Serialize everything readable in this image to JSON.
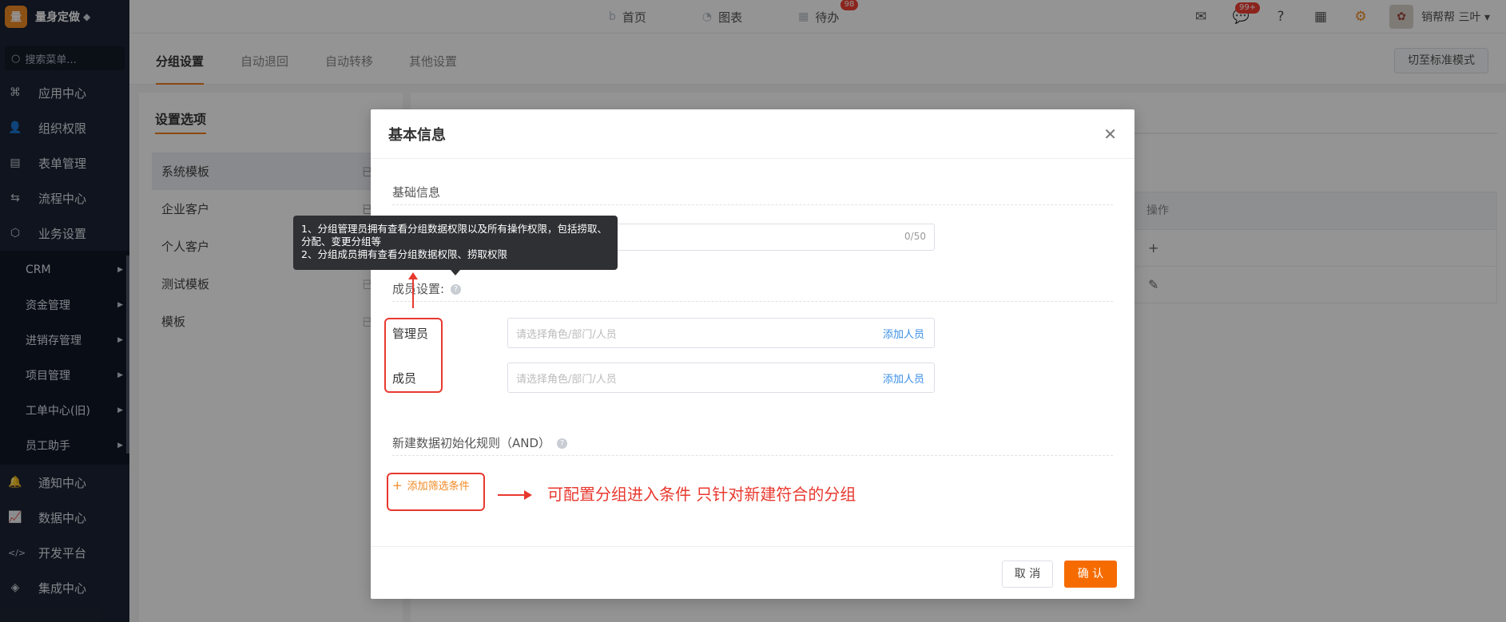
{
  "sidebar": {
    "brand_logo": "量",
    "brand_name": "量身定做",
    "search_placeholder": "搜索菜单...",
    "items_top": [
      {
        "label": "应用中心",
        "icon": "apps-icon",
        "glyph": "⌘"
      },
      {
        "label": "组织权限",
        "icon": "user-icon",
        "glyph": "👤"
      },
      {
        "label": "表单管理",
        "icon": "form-icon",
        "glyph": "▤"
      },
      {
        "label": "流程中心",
        "icon": "flow-icon",
        "glyph": "⇆"
      },
      {
        "label": "业务设置",
        "icon": "cube-icon",
        "glyph": "⬡"
      }
    ],
    "sub_items": [
      "CRM",
      "资金管理",
      "进销存管理",
      "项目管理",
      "工单中心(旧)",
      "员工助手"
    ],
    "items_bottom": [
      {
        "label": "通知中心",
        "icon": "bell-icon",
        "glyph": "🔔"
      },
      {
        "label": "数据中心",
        "icon": "chart-icon",
        "glyph": "📈"
      },
      {
        "label": "开发平台",
        "icon": "code-icon",
        "glyph": "</>"
      },
      {
        "label": "集成中心",
        "icon": "layers-icon",
        "glyph": "◈"
      }
    ]
  },
  "topbar": {
    "nav": [
      {
        "label": "首页",
        "icon": "home-icon",
        "glyph": "b"
      },
      {
        "label": "图表",
        "icon": "pie-chart-icon",
        "glyph": "◔"
      },
      {
        "label": "待办",
        "icon": "calendar-icon",
        "glyph": "▦",
        "badge": "98"
      }
    ],
    "message_badge": "99+",
    "user_name": "销帮帮 三叶 ▾",
    "avatar_glyph": "✿"
  },
  "tabs": [
    "分组设置",
    "自动退回",
    "自动转移",
    "其他设置"
  ],
  "switch_mode_label": "切至标准模式",
  "left_panel": {
    "title": "设置选项",
    "templates": [
      {
        "name": "系统模板",
        "status": "已启用",
        "active": true
      },
      {
        "name": "企业客户",
        "status": "已启用",
        "active": false
      },
      {
        "name": "个人客户",
        "status": "",
        "active": false
      },
      {
        "name": "测试模板",
        "status": "已停用",
        "active": false
      },
      {
        "name": "模板",
        "status": "已停用",
        "active": false
      }
    ]
  },
  "right_panel": {
    "ops_header": "操作",
    "ops_rows": [
      "+",
      "✎"
    ]
  },
  "modal": {
    "title": "基本信息",
    "section_basic": "基础信息",
    "name_counter": "0/50",
    "section_members": "成员设置:",
    "admin_label": "管理员",
    "member_label": "成员",
    "picker_placeholder": "请选择角色/部门/人员",
    "add_person": "添加人员",
    "section_rules": "新建数据初始化规则（AND）",
    "add_filter": "添加筛选条件",
    "cancel": "取 消",
    "confirm": "确 认"
  },
  "tooltip": {
    "line1": "1、分组管理员拥有查看分组数据权限以及所有操作权限，包括捞取、分配、变更分组等",
    "line2": "2、分组成员拥有查看分组数据权限、捞取权限"
  },
  "annotation_text": "可配置分组进入条件  只针对新建符合的分组"
}
